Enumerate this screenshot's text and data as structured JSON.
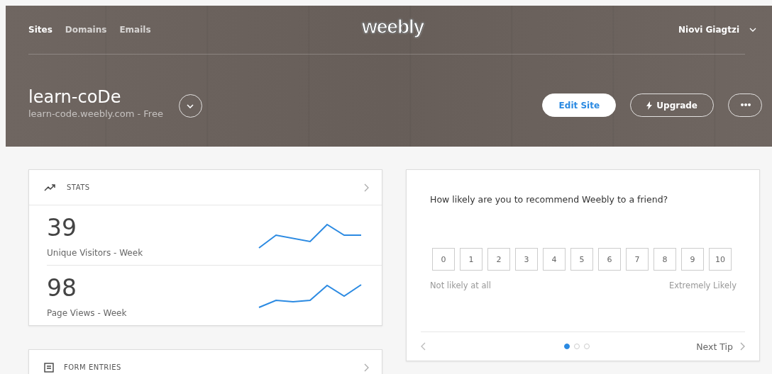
{
  "header": {
    "nav": [
      {
        "label": "Sites",
        "selected": true
      },
      {
        "label": "Domains",
        "selected": false
      },
      {
        "label": "Emails",
        "selected": false
      }
    ],
    "logo": "weebly",
    "user": "Niovi Giagtzi",
    "site": {
      "title": "learn-coDe",
      "subtitle": "learn-code.weebly.com - Free"
    },
    "buttons": [
      {
        "kind": "primary",
        "label": "Edit Site"
      },
      {
        "kind": "upgrade",
        "label": "Upgrade"
      },
      {
        "kind": "more",
        "label": "•••"
      }
    ]
  },
  "stats": {
    "title": "STATS",
    "rows": [
      {
        "value": "39",
        "label": "Unique Visitors - Week"
      },
      {
        "value": "98",
        "label": "Page Views - Week"
      }
    ]
  },
  "form_entries": {
    "title": "FORM ENTRIES"
  },
  "survey": {
    "question": "How likely are you to recommend Weebly to a friend?",
    "scale": [
      "0",
      "1",
      "2",
      "3",
      "4",
      "5",
      "6",
      "7",
      "8",
      "9",
      "10"
    ],
    "low_label": "Not likely at all",
    "high_label": "Extremely Likely",
    "pages": [
      {
        "selected": true
      },
      {
        "selected": false
      },
      {
        "selected": false
      }
    ],
    "next": "Next Tip"
  }
}
